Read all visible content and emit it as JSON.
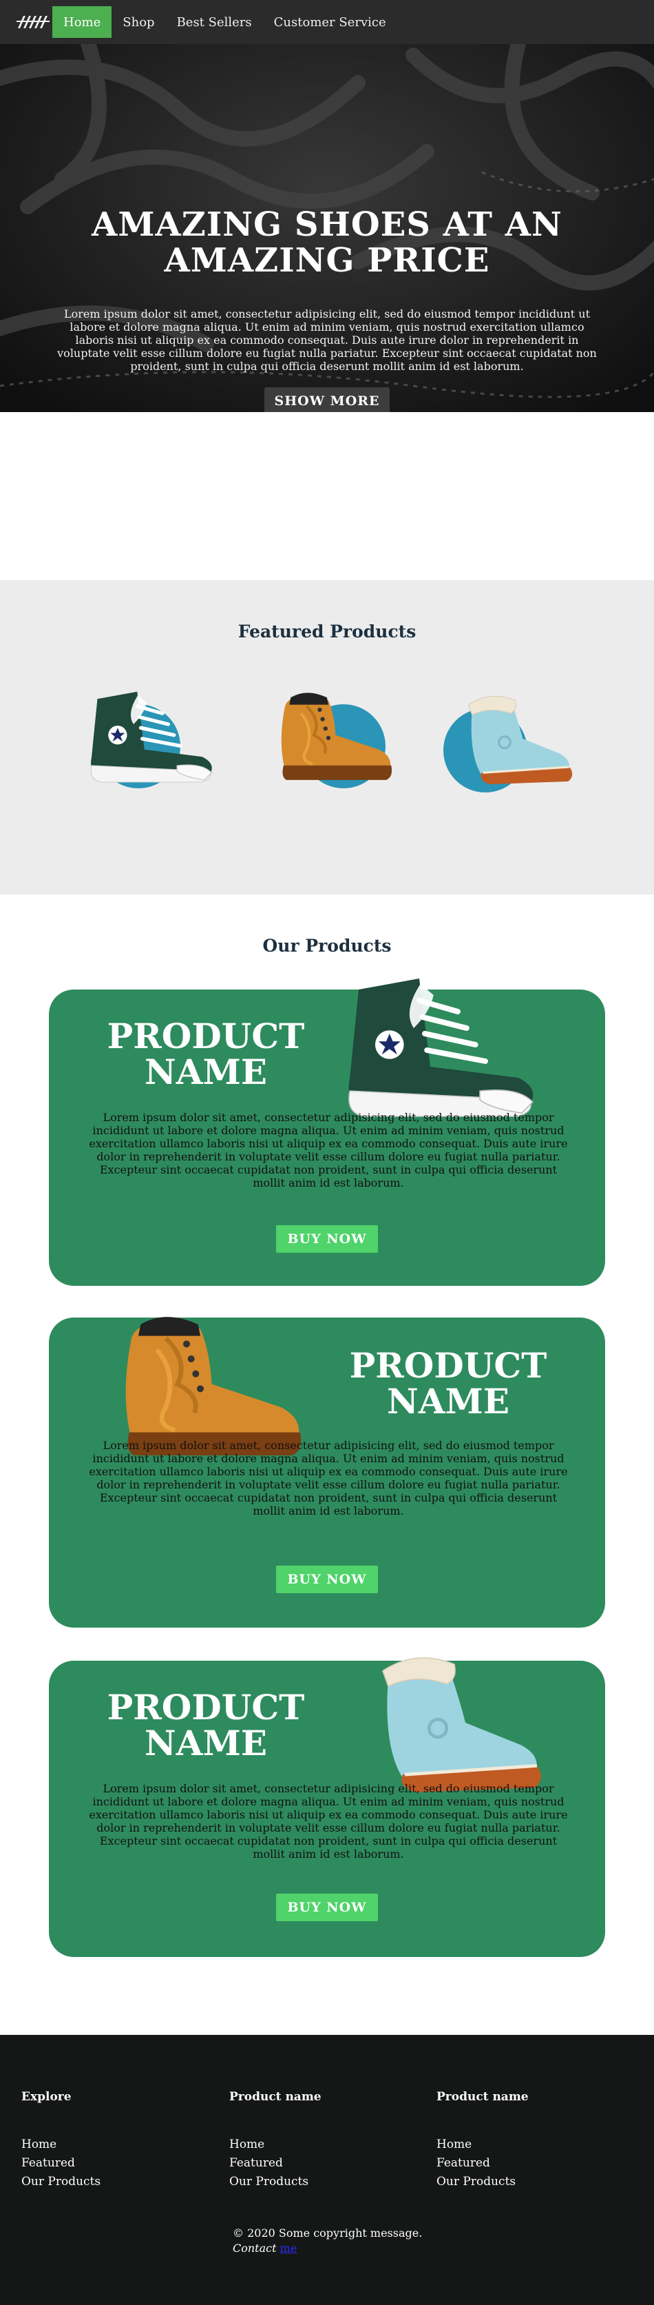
{
  "nav": {
    "links": [
      "Home",
      "Shop",
      "Best Sellers",
      "Customer Service"
    ],
    "active": "Home"
  },
  "hero": {
    "title_line1": "AMAZING SHOES AT AN",
    "title_line2": "AMAZING PRICE",
    "text": "Lorem ipsum dolor sit amet, consectetur adipisicing elit, sed do eiusmod tempor incididunt ut labore et dolore magna aliqua. Ut enim ad minim veniam, quis nostrud exercitation ullamco laboris nisi ut aliquip ex ea commodo consequat. Duis aute irure dolor in reprehenderit in voluptate velit esse cillum dolore eu fugiat nulla pariatur. Excepteur sint occaecat cupidatat non proident, sunt in culpa qui officia deserunt mollit anim id est laborum.",
    "button": "SHOW MORE"
  },
  "featured": {
    "title": "Featured Products",
    "items": [
      "sneaker-icon",
      "boot-icon",
      "winter-boot-icon"
    ]
  },
  "products": {
    "title": "Our Products",
    "cards": [
      {
        "title_line1": "PRODUCT",
        "title_line2": "NAME",
        "text": "Lorem ipsum dolor sit amet, consectetur adipisicing elit, sed do eiusmod tempor incididunt ut labore et dolore magna aliqua. Ut enim ad minim veniam, quis nostrud exercitation ullamco laboris nisi ut aliquip ex ea commodo consequat. Duis aute irure dolor in reprehenderit in voluptate velit esse cillum dolore eu fugiat nulla pariatur. Excepteur sint occaecat cupidatat non proident, sunt in culpa qui officia deserunt mollit anim id est laborum.",
        "button": "BUY NOW"
      },
      {
        "title_line1": "PRODUCT",
        "title_line2": "NAME",
        "text": "Lorem ipsum dolor sit amet, consectetur adipisicing elit, sed do eiusmod tempor incididunt ut labore et dolore magna aliqua. Ut enim ad minim veniam, quis nostrud exercitation ullamco laboris nisi ut aliquip ex ea commodo consequat. Duis aute irure dolor in reprehenderit in voluptate velit esse cillum dolore eu fugiat nulla pariatur. Excepteur sint occaecat cupidatat non proident, sunt in culpa qui officia deserunt mollit anim id est laborum.",
        "button": "BUY NOW"
      },
      {
        "title_line1": "PRODUCT",
        "title_line2": "NAME",
        "text": "Lorem ipsum dolor sit amet, consectetur adipisicing elit, sed do eiusmod tempor incididunt ut labore et dolore magna aliqua. Ut enim ad minim veniam, quis nostrud exercitation ullamco laboris nisi ut aliquip ex ea commodo consequat. Duis aute irure dolor in reprehenderit in voluptate velit esse cillum dolore eu fugiat nulla pariatur. Excepteur sint occaecat cupidatat non proident, sunt in culpa qui officia deserunt mollit anim id est laborum.",
        "button": "BUY NOW"
      }
    ]
  },
  "footer": {
    "columns": [
      {
        "heading": "Explore",
        "links": [
          "Home",
          "Featured",
          "Our Products"
        ]
      },
      {
        "heading": "Product name",
        "links": [
          "Home",
          "Featured",
          "Our Products"
        ]
      },
      {
        "heading": "Product name",
        "links": [
          "Home",
          "Featured",
          "Our Products"
        ]
      }
    ],
    "copyright": "© 2020 Some copyright message.",
    "contact_label": "Contact",
    "contact_link": "me"
  },
  "colors": {
    "nav_bg": "#2b2b2b",
    "nav_active": "#4caf50",
    "card_green": "#2e8b5e",
    "buy_button": "#4fd36a",
    "feature_circle": "#2a95b6",
    "footer_bg": "#151716"
  }
}
